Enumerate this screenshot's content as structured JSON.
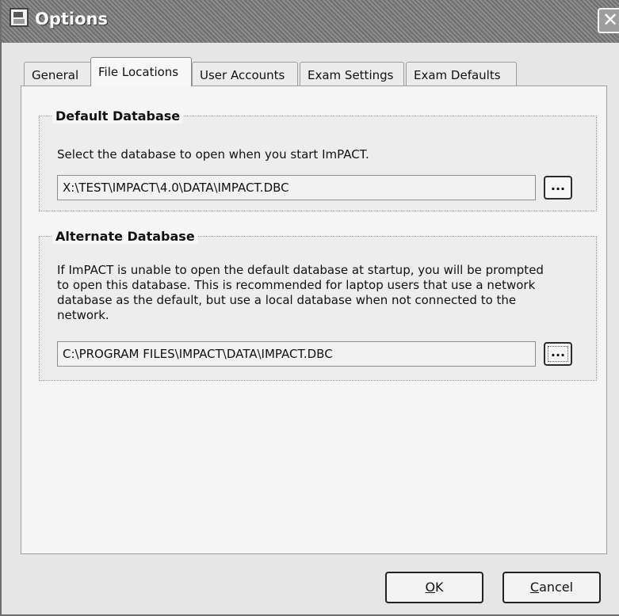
{
  "window": {
    "title": "Options",
    "icon": "options-app-icon",
    "close_icon": "close-icon"
  },
  "tabs": [
    {
      "label": "General",
      "active": false
    },
    {
      "label": "File Locations",
      "active": true
    },
    {
      "label": "User Accounts",
      "active": false
    },
    {
      "label": "Exam Settings",
      "active": false
    },
    {
      "label": "Exam Defaults",
      "active": false
    }
  ],
  "default_database": {
    "legend": "Default Database",
    "description": "Select the database to open when you start ImPACT.",
    "path": "X:\\TEST\\IMPACT\\4.0\\DATA\\IMPACT.DBC",
    "browse_label": "..."
  },
  "alternate_database": {
    "legend": "Alternate Database",
    "description_lines": [
      "If ImPACT is unable to open the default database at startup, you will be prompted",
      "to open this database.  This is recommended for laptop users that use a network",
      "database as the default, but use a local database when not connected to the",
      "network."
    ],
    "path": "C:\\PROGRAM FILES\\IMPACT\\DATA\\IMPACT.DBC",
    "browse_label": "..."
  },
  "buttons": {
    "ok": {
      "mnemonic": "O",
      "rest": "K"
    },
    "cancel": {
      "mnemonic": "C",
      "rest": "ancel"
    }
  }
}
